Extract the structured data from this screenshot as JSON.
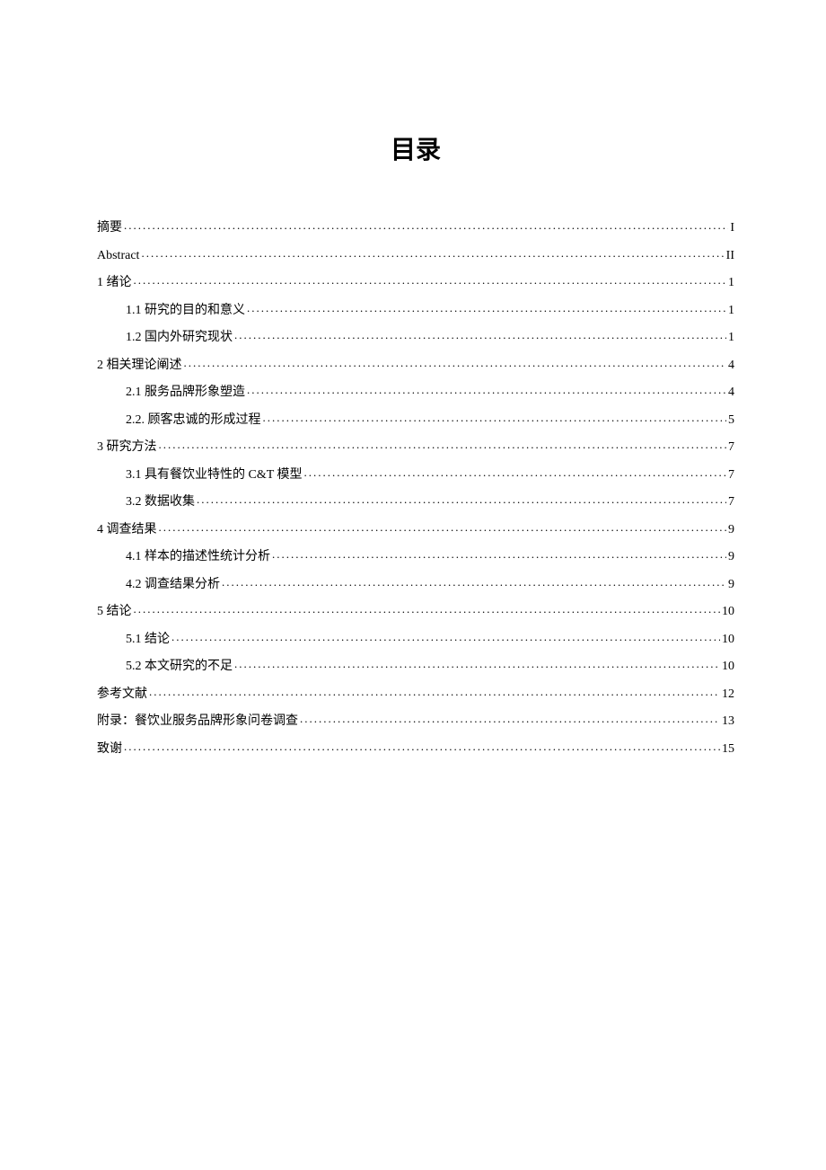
{
  "title": "目录",
  "entries": [
    {
      "level": 1,
      "label": "摘要",
      "page": "I"
    },
    {
      "level": 1,
      "label": "Abstract",
      "page": "II"
    },
    {
      "level": 1,
      "label": "1 绪论",
      "page": "1"
    },
    {
      "level": 2,
      "label": "1.1 研究的目的和意义",
      "page": "1"
    },
    {
      "level": 2,
      "label": "1.2 国内外研究现状",
      "page": "1"
    },
    {
      "level": 1,
      "label": "2 相关理论阐述",
      "page": "4"
    },
    {
      "level": 2,
      "label": "2.1 服务品牌形象塑造",
      "page": "4"
    },
    {
      "level": 2,
      "label": "2.2. 顾客忠诚的形成过程",
      "page": "5"
    },
    {
      "level": 1,
      "label": "3 研究方法",
      "page": "7"
    },
    {
      "level": 2,
      "label": "3.1 具有餐饮业特性的 C&T 模型",
      "page": "7"
    },
    {
      "level": 2,
      "label": "3.2 数据收集",
      "page": "7"
    },
    {
      "level": 1,
      "label": "4 调查结果",
      "page": "9"
    },
    {
      "level": 2,
      "label": "4.1 样本的描述性统计分析",
      "page": "9"
    },
    {
      "level": 2,
      "label": "4.2 调查结果分析",
      "page": "9"
    },
    {
      "level": 1,
      "label": "5 结论",
      "page": "10"
    },
    {
      "level": 2,
      "label": "5.1  结论",
      "page": "10"
    },
    {
      "level": 2,
      "label": "5.2  本文研究的不足",
      "page": "10"
    },
    {
      "level": 1,
      "label": "参考文献",
      "page": "12"
    },
    {
      "level": 1,
      "label": "附录：餐饮业服务品牌形象问卷调查",
      "page": "13"
    },
    {
      "level": 1,
      "label": "致谢",
      "page": "15"
    }
  ]
}
